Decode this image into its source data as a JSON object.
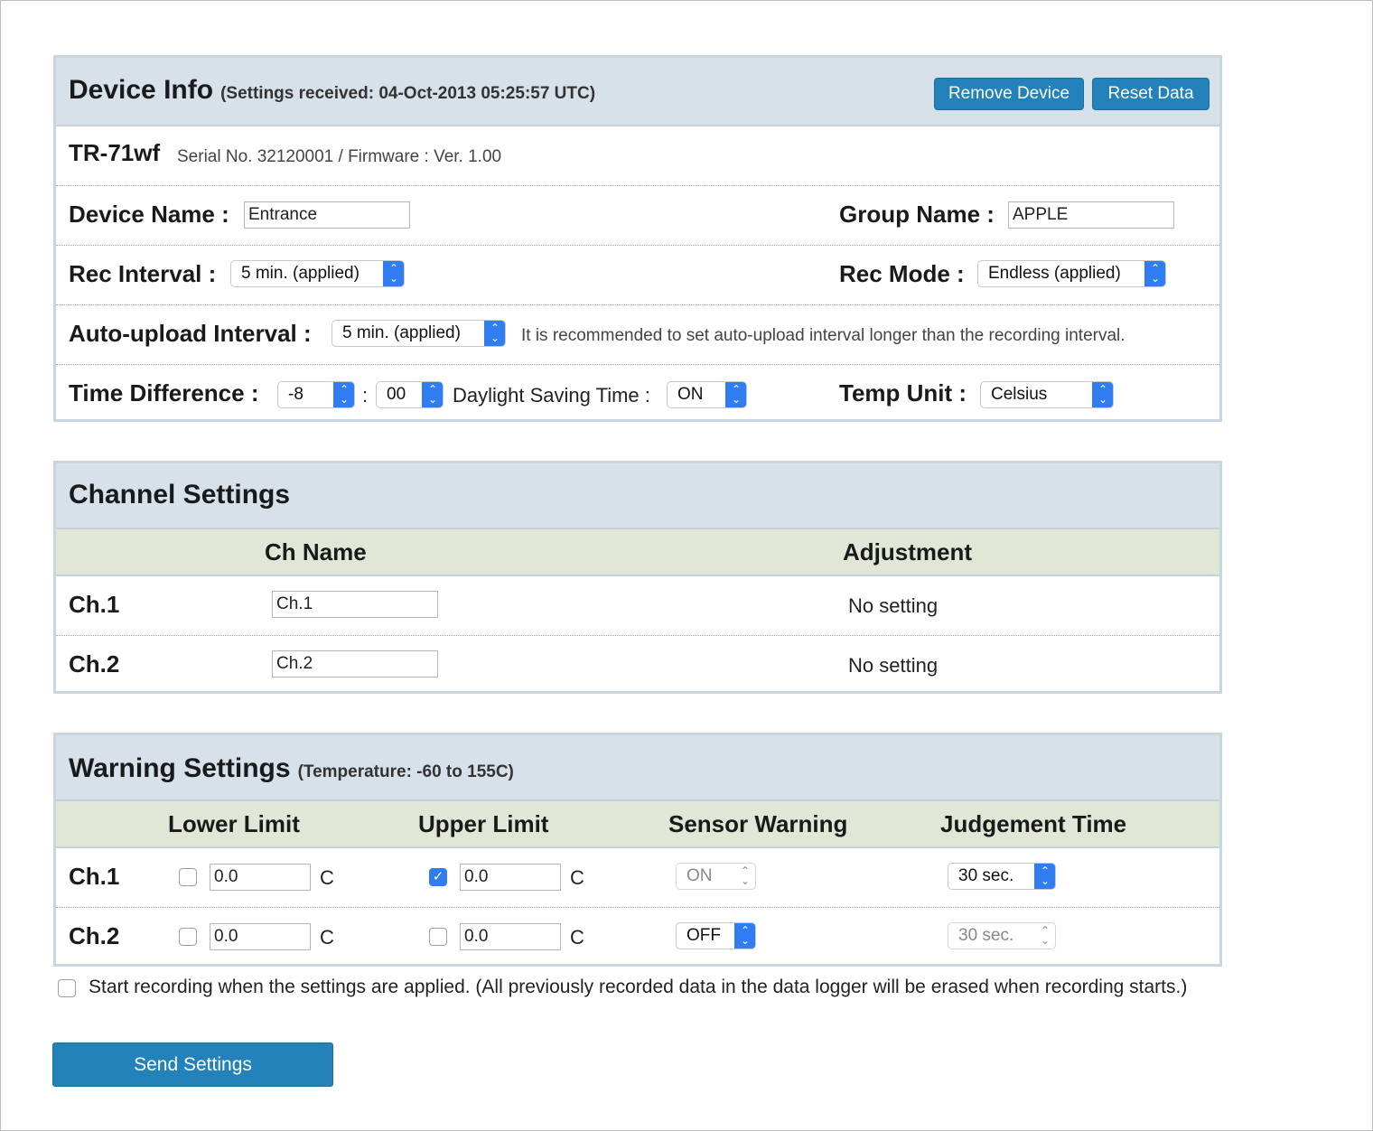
{
  "device_info": {
    "title": "Device Info",
    "subtitle": "(Settings received: 04-Oct-2013 05:25:57 UTC)",
    "remove_label": "Remove Device",
    "reset_label": "Reset Data",
    "model": "TR-71wf",
    "serial_firmware": "Serial No. 32120001 / Firmware : Ver. 1.00",
    "device_name_label": "Device Name :",
    "device_name_value": "Entrance",
    "group_name_label": "Group Name :",
    "group_name_value": "APPLE",
    "rec_interval_label": "Rec Interval :",
    "rec_interval_value": "5 min. (applied)",
    "rec_mode_label": "Rec Mode :",
    "rec_mode_value": "Endless (applied)",
    "auto_upload_label": "Auto-upload Interval :",
    "auto_upload_value": "5 min. (applied)",
    "auto_upload_note": "It is recommended to set auto-upload interval longer than the recording interval.",
    "time_diff_label": "Time Difference :",
    "time_diff_hours": "-8",
    "time_diff_sep": ":",
    "time_diff_minutes": "00",
    "dst_label": "Daylight Saving Time :",
    "dst_value": "ON",
    "temp_unit_label": "Temp Unit :",
    "temp_unit_value": "Celsius"
  },
  "channel_settings": {
    "title": "Channel Settings",
    "col_name": "Ch Name",
    "col_adjust": "Adjustment",
    "rows": [
      {
        "label": "Ch.1",
        "name": "Ch.1",
        "adjust": "No setting"
      },
      {
        "label": "Ch.2",
        "name": "Ch.2",
        "adjust": "No setting"
      }
    ]
  },
  "warning_settings": {
    "title": "Warning Settings",
    "subtitle": "(Temperature: -60 to 155C)",
    "col_lower": "Lower Limit",
    "col_upper": "Upper Limit",
    "col_sensor": "Sensor Warning",
    "col_judge": "Judgement Time",
    "unit": "C",
    "rows": [
      {
        "label": "Ch.1",
        "lower_checked": false,
        "lower": "0.0",
        "upper_checked": true,
        "upper": "0.0",
        "sensor": "ON",
        "sensor_enabled": false,
        "judge": "30 sec.",
        "judge_enabled": true
      },
      {
        "label": "Ch.2",
        "lower_checked": false,
        "lower": "0.0",
        "upper_checked": false,
        "upper": "0.0",
        "sensor": "OFF",
        "sensor_enabled": true,
        "judge": "30 sec.",
        "judge_enabled": false
      }
    ]
  },
  "start_recording_label": "Start recording when the settings are applied. (All previously recorded data in the data logger will be erased when recording starts.)",
  "send_label": "Send Settings",
  "colors": {
    "accent": "#2482ba",
    "select_arrow": "#2f7df0",
    "panel_head": "#d7e1e9",
    "table_head": "#e0e7d6"
  }
}
